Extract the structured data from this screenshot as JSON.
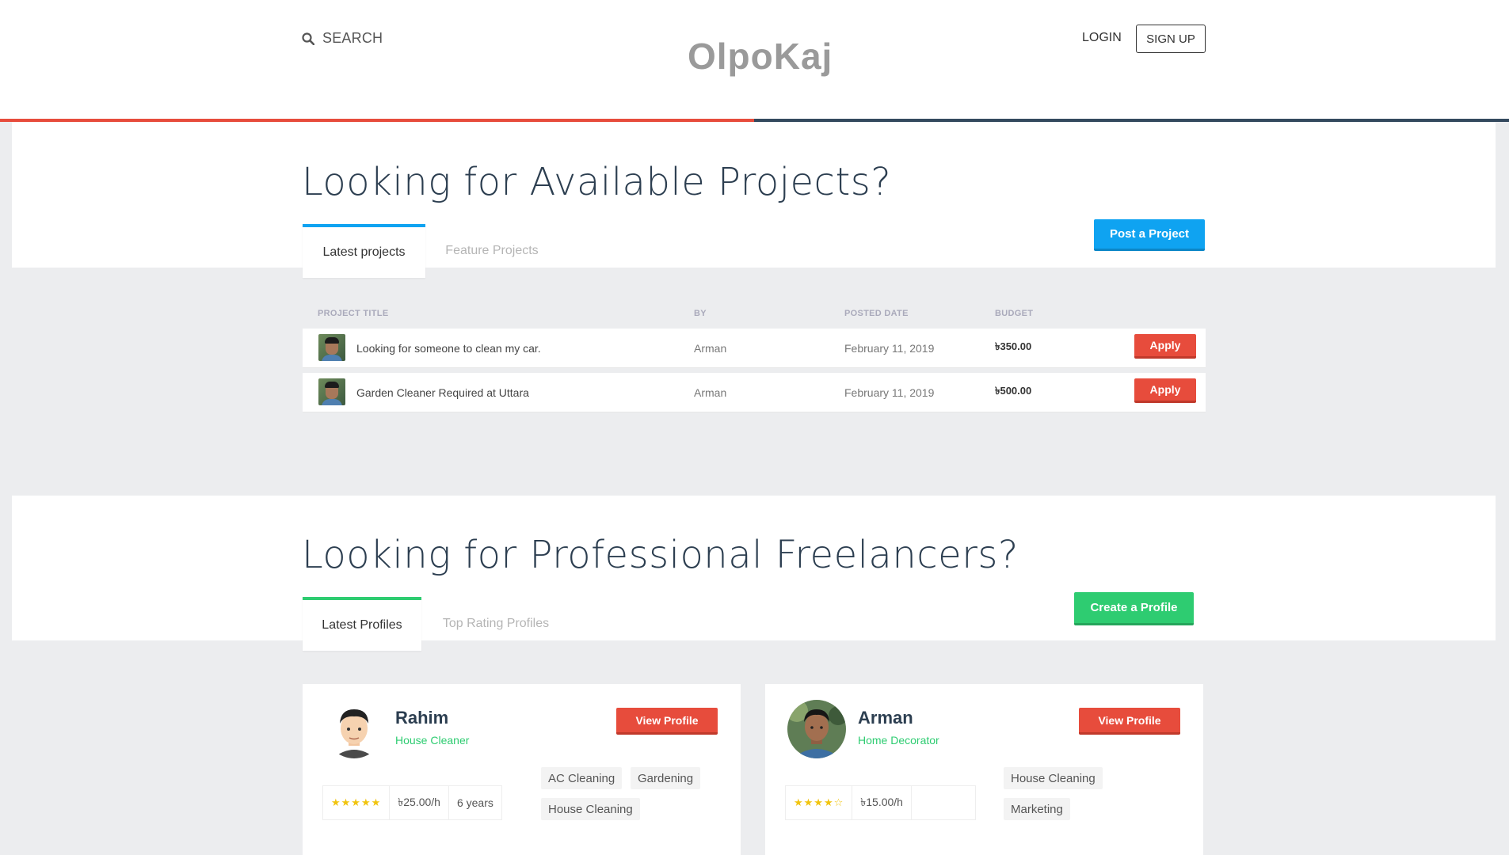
{
  "header": {
    "search_label": "SEARCH",
    "logo": "OlpoKaj",
    "login": "LOGIN",
    "signup": "SIGN UP"
  },
  "projects": {
    "title": "Looking for Available Projects?",
    "tabs": [
      {
        "label": "Latest projects",
        "active": true
      },
      {
        "label": "Feature Projects",
        "active": false
      }
    ],
    "post_button": "Post a Project",
    "columns": [
      "PROJECT TITLE",
      "BY",
      "POSTED DATE",
      "BUDGET"
    ],
    "rows": [
      {
        "title": "Looking for someone to clean my car.",
        "by": "Arman",
        "date": "February 11, 2019",
        "budget": "৳350.00",
        "action": "Apply"
      },
      {
        "title": "Garden Cleaner Required at Uttara",
        "by": "Arman",
        "date": "February 11, 2019",
        "budget": "৳500.00",
        "action": "Apply"
      }
    ]
  },
  "freelancers": {
    "title": "Looking for Professional Freelancers?",
    "tabs": [
      {
        "label": "Latest Profiles",
        "active": true
      },
      {
        "label": "Top Rating Profiles",
        "active": false
      }
    ],
    "create_button": "Create a Profile",
    "profiles": [
      {
        "name": "Rahim",
        "role": "House Cleaner",
        "view_button": "View Profile",
        "rating": 5,
        "rating_display": "★★★★★",
        "rate": "৳25.00/h",
        "experience": "6 years",
        "skills": [
          "AC Cleaning",
          "Gardening",
          "House Cleaning"
        ]
      },
      {
        "name": "Arman",
        "role": "Home Decorator",
        "view_button": "View Profile",
        "rating": 4,
        "rating_display": "★★★★☆",
        "rate": "৳15.00/h",
        "experience": "",
        "skills": [
          "House Cleaning",
          "Marketing"
        ]
      }
    ]
  },
  "colors": {
    "accent_red": "#e74c3c",
    "accent_blue": "#0fa3f1",
    "accent_green": "#2ecc71",
    "heading": "#2c3e50"
  }
}
